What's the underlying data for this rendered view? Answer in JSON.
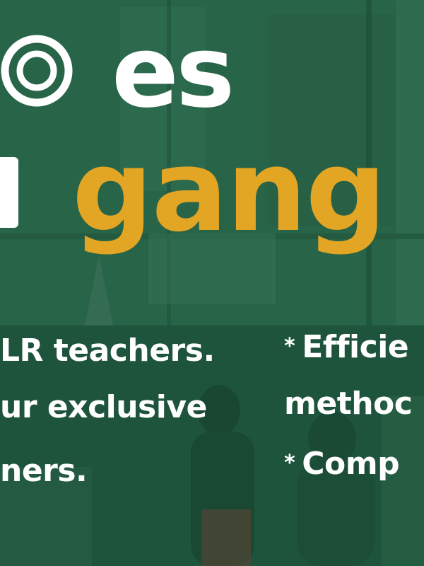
{
  "headline": {
    "top_word": "es",
    "bottom_word": "gang"
  },
  "colors": {
    "accent": "#e3a524",
    "overlay": "#1e5a3d",
    "text": "#ffffff"
  },
  "icons": [
    "circle-ring-icon",
    "asterisk-bullet-icon"
  ],
  "left_column": [
    "LR teachers.",
    "ur exclusive",
    "ners."
  ],
  "right_column": {
    "bullet": "*",
    "items": [
      "Efficie",
      "methoc",
      "Comp"
    ]
  }
}
